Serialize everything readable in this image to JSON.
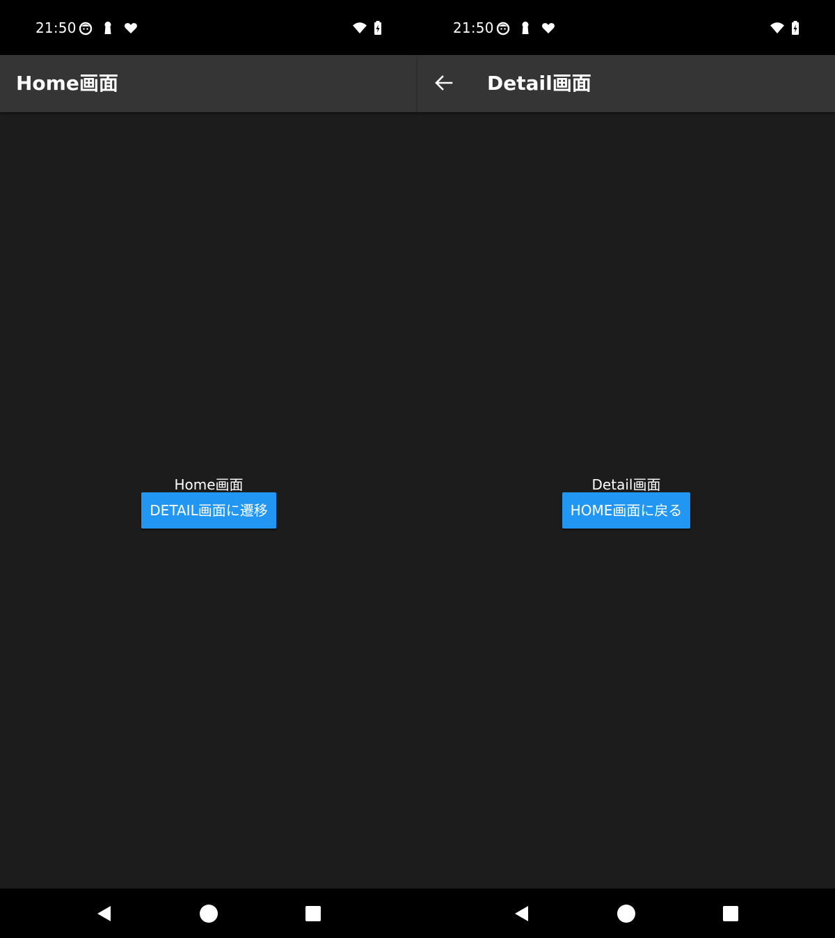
{
  "colors": {
    "status_bar_bg": "#000000",
    "app_bar_bg": "#353535",
    "content_bg": "#1c1c1c",
    "button_bg": "#2196f3",
    "text": "#ffffff"
  },
  "screens": {
    "home": {
      "status_time": "21:50",
      "status_icons": [
        "cat-face-icon",
        "keyhole-icon",
        "heart-icon",
        "wifi-icon",
        "battery-charging-icon"
      ],
      "app_title": "Home画面",
      "center_text": "Home画面",
      "button_label": "DETAIL画面に遷移",
      "nav_icons": [
        "nav-back-icon",
        "nav-home-icon",
        "nav-recents-icon"
      ]
    },
    "detail": {
      "status_time": "21:50",
      "status_icons": [
        "cat-face-icon",
        "keyhole-icon",
        "heart-icon",
        "wifi-icon",
        "battery-charging-icon"
      ],
      "app_bar_icon": "back-arrow-icon",
      "app_title": "Detail画面",
      "center_text": "Detail画面",
      "button_label": "HOME画面に戻る",
      "nav_icons": [
        "nav-back-icon",
        "nav-home-icon",
        "nav-recents-icon"
      ]
    }
  }
}
